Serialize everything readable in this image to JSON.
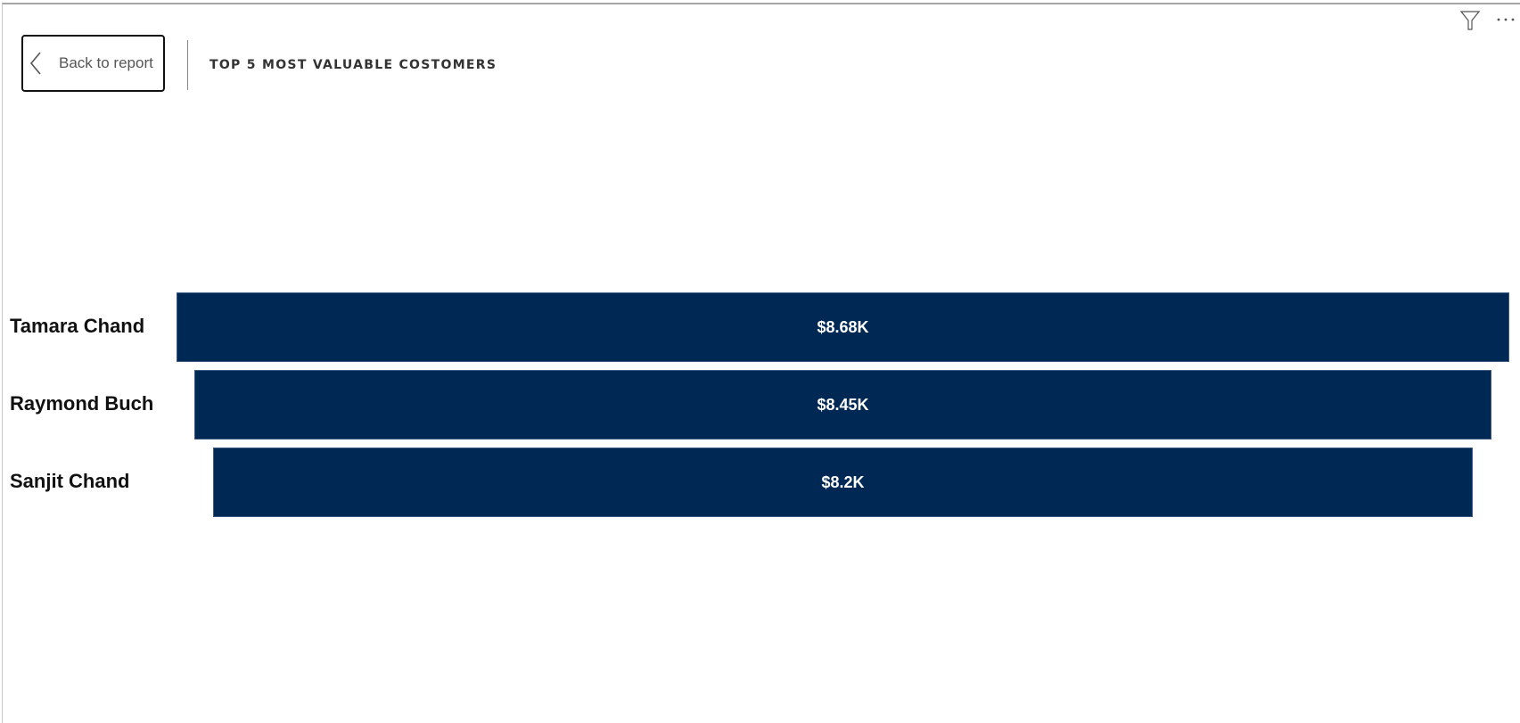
{
  "header": {
    "back_label": "Back to report",
    "title": "TOP 5 MOST VALUABLE COSTOMERS"
  },
  "toolbar": {
    "filter_icon": "funnel-icon",
    "more_icon": "more-options-icon"
  },
  "chart_data": {
    "type": "funnel",
    "bar_color": "#002855",
    "categories": [
      "Tamara Chand",
      "Raymond Buch",
      "Sanjit Chand"
    ],
    "values": [
      8680,
      8450,
      8200
    ],
    "data_labels": [
      "$8.68K",
      "$8.45K",
      "$8.2K"
    ]
  }
}
